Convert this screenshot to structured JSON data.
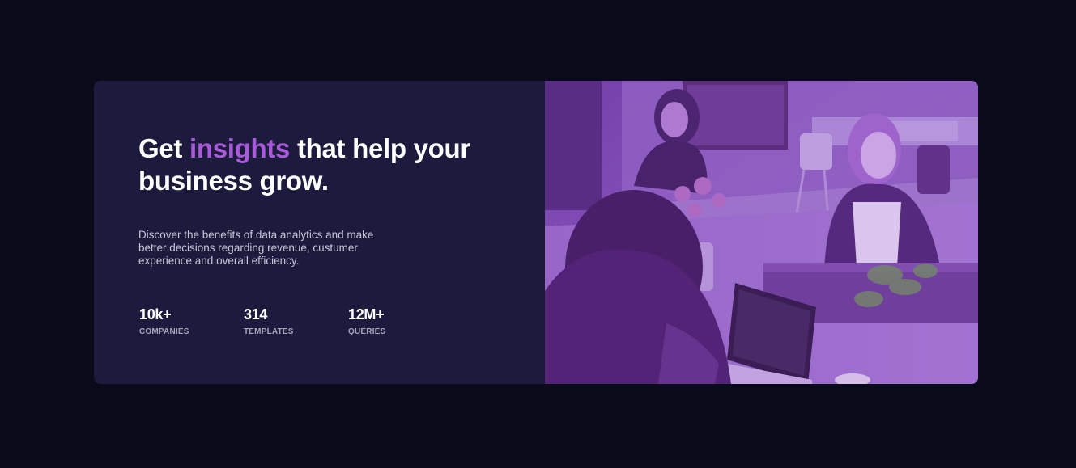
{
  "card": {
    "headline_before": "Get ",
    "headline_accent": "insights",
    "headline_after": " that help your business grow.",
    "description": "Discover the benefits of data analytics and make better decisions regarding revenue, custumer experience and overall efficiency.",
    "stats": [
      {
        "value": "10k+",
        "label": "COMPANIES"
      },
      {
        "value": "314",
        "label": "TEMPLATES"
      },
      {
        "value": "12M+",
        "label": "QUERIES"
      }
    ]
  },
  "colors": {
    "page_bg": "#090b1a",
    "card_bg": "#1c1a3d",
    "accent": "#a85ad8",
    "photo_overlay": "#8a4fbf"
  },
  "image": {
    "subject": "people-working-at-desk-photo"
  }
}
